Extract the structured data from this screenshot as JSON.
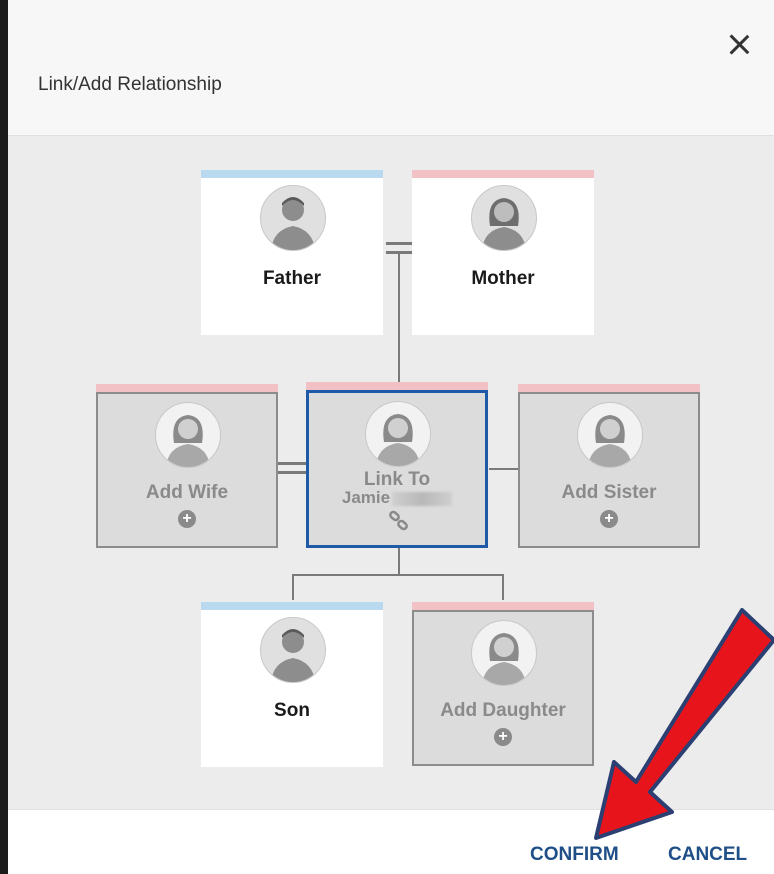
{
  "dialog": {
    "title": "Link/Add Relationship",
    "close_icon": "close-icon"
  },
  "tree": {
    "father": {
      "label": "Father",
      "gender": "male",
      "icon": "male-avatar-icon"
    },
    "mother": {
      "label": "Mother",
      "gender": "female",
      "icon": "female-avatar-icon"
    },
    "wife": {
      "label": "Add Wife",
      "gender": "female",
      "icon": "female-avatar-icon",
      "action_icon": "plus-circle-icon"
    },
    "self": {
      "line1": "Link To",
      "line2": "Jamie",
      "icon": "female-avatar-icon",
      "action_icon": "link-icon"
    },
    "sister": {
      "label": "Add Sister",
      "gender": "female",
      "icon": "female-avatar-icon",
      "action_icon": "plus-circle-icon"
    },
    "son": {
      "label": "Son",
      "gender": "male",
      "icon": "male-avatar-icon"
    },
    "daughter": {
      "label": "Add Daughter",
      "gender": "female",
      "icon": "female-avatar-icon",
      "action_icon": "plus-circle-icon"
    }
  },
  "footer": {
    "confirm_label": "CONFIRM",
    "cancel_label": "CANCEL"
  },
  "colors": {
    "accent": "#1f4f86",
    "selected_border": "#1e5aa8",
    "male_bar": "#b9d9ee",
    "female_bar": "#f2c1c5",
    "annotation_arrow": "#e8141c"
  }
}
